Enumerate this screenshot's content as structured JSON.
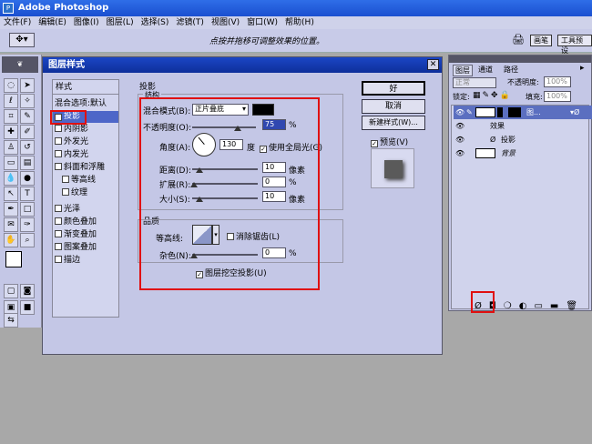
{
  "app": {
    "title": "Adobe Photoshop",
    "icon": "photoshop-icon"
  },
  "menu": [
    "文件(F)",
    "编辑(E)",
    "图像(I)",
    "图层(L)",
    "选择(S)",
    "滤镜(T)",
    "视图(V)",
    "窗口(W)",
    "帮助(H)"
  ],
  "options_bar": {
    "hint": "点按并拖移可调整效果的位置。",
    "tab_brushes": "画笔",
    "tab_presets": "工具预设"
  },
  "dialog": {
    "title": "图层样式",
    "list_header": "样式",
    "styles": [
      {
        "label": "混合选项:默认",
        "checkable": false,
        "checked": false
      },
      {
        "label": "投影",
        "checkable": true,
        "checked": true
      },
      {
        "label": "内阴影",
        "checkable": true,
        "checked": false
      },
      {
        "label": "外发光",
        "checkable": true,
        "checked": false
      },
      {
        "label": "内发光",
        "checkable": true,
        "checked": false
      },
      {
        "label": "斜面和浮雕",
        "checkable": true,
        "checked": false
      },
      {
        "label": "等高线",
        "checkable": true,
        "checked": false
      },
      {
        "label": "纹理",
        "checkable": true,
        "checked": false
      },
      {
        "label": "光泽",
        "checkable": true,
        "checked": false
      },
      {
        "label": "颜色叠加",
        "checkable": true,
        "checked": false
      },
      {
        "label": "渐变叠加",
        "checkable": true,
        "checked": false
      },
      {
        "label": "图案叠加",
        "checkable": true,
        "checked": false
      },
      {
        "label": "描边",
        "checkable": true,
        "checked": false
      }
    ],
    "section_title": "投影",
    "structure": {
      "title": "结构",
      "blend_mode_label": "混合模式(B):",
      "blend_mode_value": "正片叠底",
      "opacity_label": "不透明度(O):",
      "opacity_value": "75",
      "opacity_unit": "%",
      "angle_label": "角度(A):",
      "angle_value": "130",
      "angle_unit": "度",
      "global_light_label": "使用全局光(G)",
      "global_light_checked": true,
      "distance_label": "距离(D):",
      "distance_value": "10",
      "distance_unit": "像素",
      "spread_label": "扩展(R):",
      "spread_value": "0",
      "spread_unit": "%",
      "size_label": "大小(S):",
      "size_value": "10",
      "size_unit": "像素"
    },
    "quality": {
      "title": "品质",
      "contour_label": "等高线:",
      "antialias_label": "消除锯齿(L)",
      "antialias_checked": false,
      "noise_label": "杂色(N):",
      "noise_value": "0",
      "noise_unit": "%"
    },
    "knockout_label": "图层挖空投影(U)",
    "knockout_checked": true,
    "buttons": {
      "ok": "好",
      "cancel": "取消",
      "new_style": "新建样式(W)...",
      "preview": "预览(V)"
    },
    "preview_checked": true
  },
  "layers_panel": {
    "tabs": [
      "图层",
      "通道",
      "路径"
    ],
    "blend": "正常",
    "opacity_label": "不透明度:",
    "opacity_value": "100%",
    "lock_label": "锁定:",
    "fill_label": "填充:",
    "fill_value": "100%",
    "layer_name": "图...",
    "effects_label": "效果",
    "effect_item": "投影",
    "background_label": "背景"
  }
}
